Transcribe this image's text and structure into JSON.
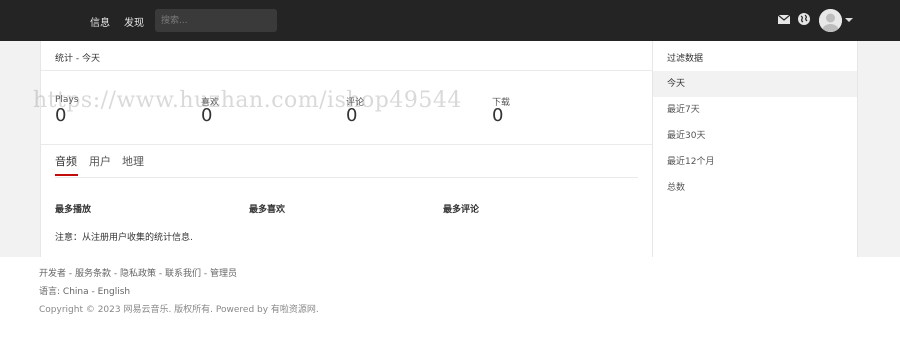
{
  "topbar": {
    "nav": [
      "信息",
      "发现"
    ],
    "search_placeholder": "搜索..."
  },
  "stats_panel": {
    "title": "统计 - 今天",
    "stats": [
      {
        "label": "Plays",
        "value": "0"
      },
      {
        "label": "喜欢",
        "value": "0"
      },
      {
        "label": "评论",
        "value": "0"
      },
      {
        "label": "下载",
        "value": "0"
      }
    ],
    "tabs": [
      "音频",
      "用户",
      "地理"
    ],
    "active_tab": "音频",
    "columns": [
      "最多播放",
      "最多喜欢",
      "最多评论"
    ],
    "note": "注意：从注册用户收集的统计信息."
  },
  "filter_panel": {
    "title": "过滤数据",
    "items": [
      "今天",
      "最近7天",
      "最近30天",
      "最近12个月",
      "总数"
    ],
    "active_item": "今天"
  },
  "footer": {
    "links": [
      "开发者",
      "服务条款",
      "隐私政策",
      "联系我们",
      "管理员"
    ],
    "separator": " - ",
    "language_label": "语言:",
    "languages": [
      "China",
      "English"
    ],
    "copyright": "Copyright © 2023 网易云音乐. 版权所有. Powered by 有啦资源网."
  },
  "watermark": "https://www.huzhan.com/ishop49544",
  "colors": {
    "topbar": "#242424",
    "accent": "#c20c0c",
    "band": "#f2f2f2"
  },
  "icons": [
    "mail-icon",
    "globe-icon",
    "avatar",
    "caret-down-icon"
  ]
}
